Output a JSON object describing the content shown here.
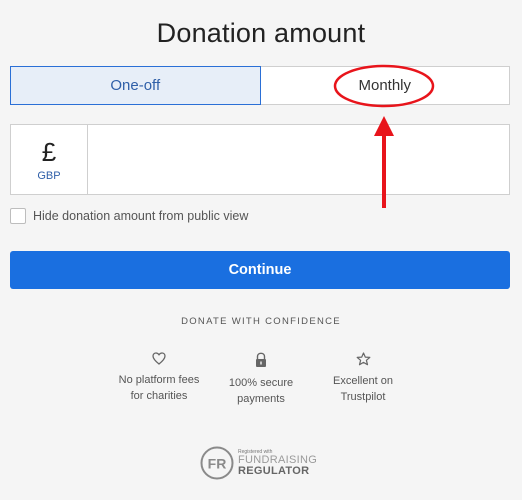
{
  "page_title": "Donation amount",
  "frequency": {
    "options": [
      "One-off",
      "Monthly"
    ],
    "selected": "One-off"
  },
  "amount": {
    "currency_symbol": "£",
    "currency_code": "GBP",
    "value": "",
    "placeholder": ""
  },
  "hide_amount": {
    "label": "Hide donation amount from public view",
    "checked": false
  },
  "continue_label": "Continue",
  "confidence_heading": "DONATE WITH CONFIDENCE",
  "features": [
    {
      "icon": "heart-icon",
      "line1": "No platform fees",
      "line2": "for charities"
    },
    {
      "icon": "lock-icon",
      "line1": "100% secure",
      "line2": "payments"
    },
    {
      "icon": "star-icon",
      "line1": "Excellent on",
      "line2": "Trustpilot"
    }
  ],
  "regulator": {
    "line1": "Registered with",
    "line2": "FUNDRAISING",
    "line3": "REGULATOR"
  },
  "colors": {
    "accent": "#1a6fe0",
    "selected_bg": "#e7eef8",
    "annotation": "#e8141b"
  }
}
